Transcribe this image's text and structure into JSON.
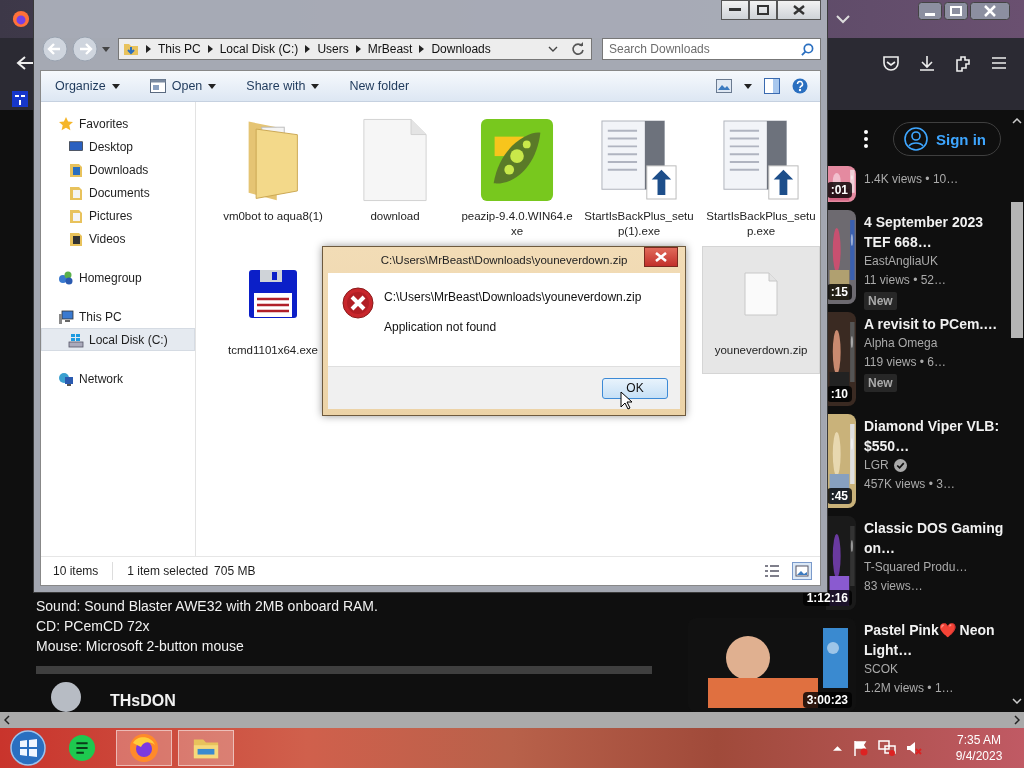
{
  "youtube": {
    "sign_in": "Sign in",
    "description_lines": [
      "Sound: Sound Blaster AWE32 with 2MB onboard RAM.",
      "CD: PCemCD 72x",
      "Mouse: Microsoft 2-button mouse"
    ],
    "commenter": "THsDON",
    "videos": [
      {
        "views": "1.4K views • 10…",
        "duration": ":01"
      },
      {
        "title": "4 September 2023 TEF 668…",
        "channel": "EastAngliaUK",
        "views": "11 views • 52…",
        "duration": ":15",
        "verified": false,
        "badge": "New"
      },
      {
        "title": "A revisit to PCem.…",
        "channel": "Alpha Omega",
        "views": "119 views • 6…",
        "duration": ":10",
        "verified": false,
        "badge": "New"
      },
      {
        "title": "Diamond Viper VLB: $550…",
        "channel": "LGR",
        "views": "457K views • 3…",
        "duration": ":45",
        "verified": true
      },
      {
        "title": "Classic DOS Gaming on…",
        "channel": "T-Squared Produ…",
        "views": "83 views…",
        "duration": "1:12:16",
        "verified": false
      },
      {
        "title": "Pastel Pink❤️ Neon Light…",
        "channel": "SCOK",
        "views": "1.2M views • 1…",
        "duration": "3:00:23",
        "verified": false
      }
    ]
  },
  "explorer": {
    "breadcrumbs": [
      "This PC",
      "Local Disk (C:)",
      "Users",
      "MrBeast",
      "Downloads"
    ],
    "search": {
      "placeholder": "Search Downloads"
    },
    "toolbar": [
      {
        "label": "Organize",
        "kind": "menu",
        "dropdown": true
      },
      {
        "label": "Open",
        "kind": "open-with",
        "dropdown": true
      },
      {
        "label": "Share with",
        "kind": "menu",
        "dropdown": true
      },
      {
        "label": "New folder",
        "kind": "action",
        "dropdown": false
      }
    ],
    "nav": [
      {
        "label": "Favorites",
        "kind": "favorites",
        "selected": false,
        "children": [
          {
            "label": "Desktop",
            "kind": "desktop",
            "selected": false
          },
          {
            "label": "Downloads",
            "kind": "downloads",
            "selected": false
          },
          {
            "label": "Documents",
            "kind": "documents",
            "selected": false
          },
          {
            "label": "Pictures",
            "kind": "pictures",
            "selected": false
          },
          {
            "label": "Videos",
            "kind": "videos",
            "selected": false
          }
        ]
      },
      {
        "label": "Homegroup",
        "kind": "homegroup",
        "selected": false
      },
      {
        "label": "This PC",
        "kind": "pc",
        "selected": false,
        "children": [
          {
            "label": "Local Disk (C:)",
            "kind": "disk",
            "selected": true
          }
        ]
      },
      {
        "label": "Network",
        "kind": "network",
        "selected": false
      }
    ],
    "files": [
      {
        "name": "vm0bot to aqua8(1)",
        "kind": "folder",
        "selected": false
      },
      {
        "name": "download",
        "kind": "blank",
        "selected": false
      },
      {
        "name": "peazip-9.4.0.WIN64.exe",
        "kind": "peazip",
        "selected": false
      },
      {
        "name": "StartIsBackPlus_setup(1).exe",
        "kind": "installer",
        "selected": false
      },
      {
        "name": "StartIsBackPlus_setup.exe",
        "kind": "installer",
        "selected": false
      },
      {
        "name": "tcmd1101x64.exe",
        "kind": "floppy",
        "selected": false
      },
      {
        "name": "youneverdown.zip",
        "kind": "blank-small",
        "selected": true
      }
    ],
    "status": {
      "count": "10 items",
      "selection": "1 item selected",
      "size": "705 MB"
    }
  },
  "dialog": {
    "title": "C:\\Users\\MrBeast\\Downloads\\youneverdown.zip",
    "path": "C:\\Users\\MrBeast\\Downloads\\youneverdown.zip",
    "message": "Application not found",
    "button": "OK"
  },
  "taskbar": {
    "apps": [
      {
        "kind": "sheets",
        "running": false
      },
      {
        "kind": "firefox",
        "running": true
      },
      {
        "kind": "explorer",
        "running": true
      }
    ],
    "time": "7:35 AM",
    "date": "9/4/2023"
  }
}
